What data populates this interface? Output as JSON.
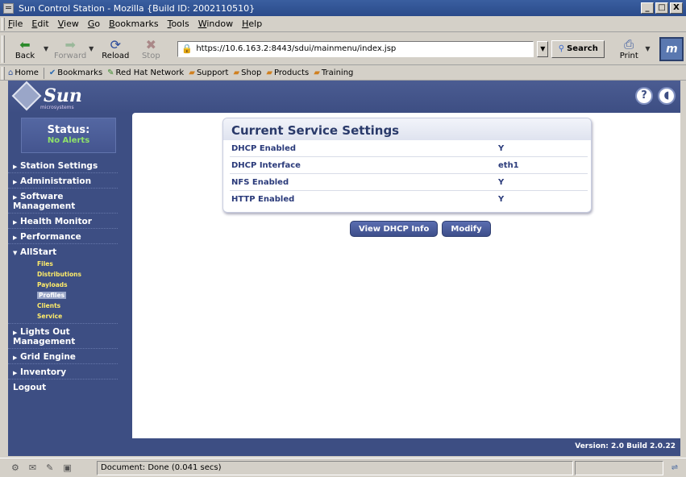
{
  "window": {
    "title": "Sun Control Station - Mozilla {Build ID: 2002110510}",
    "controls": [
      "_",
      "□",
      "X"
    ]
  },
  "menubar": [
    "File",
    "Edit",
    "View",
    "Go",
    "Bookmarks",
    "Tools",
    "Window",
    "Help"
  ],
  "toolbar": {
    "back": "Back",
    "forward": "Forward",
    "reload": "Reload",
    "stop": "Stop",
    "url": "https://10.6.163.2:8443/sdui/mainmenu/index.jsp",
    "search": "Search",
    "print": "Print"
  },
  "bookmarks": [
    "Home",
    "Bookmarks",
    "Red Hat Network",
    "Support",
    "Shop",
    "Products",
    "Training"
  ],
  "page": {
    "status_label": "Status:",
    "status_value": "No Alerts",
    "nav": [
      {
        "label": "Station Settings",
        "arrow": "right"
      },
      {
        "label": "Administration",
        "arrow": "right"
      },
      {
        "label": "Software Management",
        "arrow": "right"
      },
      {
        "label": "Health Monitor",
        "arrow": "right"
      },
      {
        "label": "Performance",
        "arrow": "right"
      },
      {
        "label": "AllStart",
        "arrow": "down"
      },
      {
        "label": "Lights Out Management",
        "arrow": "right"
      },
      {
        "label": "Grid Engine",
        "arrow": "right"
      },
      {
        "label": "Inventory",
        "arrow": "right"
      },
      {
        "label": "Logout",
        "arrow": "none"
      }
    ],
    "allstart_sub": [
      "Files",
      "Distributions",
      "Payloads",
      "Profiles",
      "Clients",
      "Service"
    ],
    "selected_sub": "Profiles",
    "card": {
      "title": "Current Service Settings",
      "rows": [
        {
          "key": "DHCP Enabled",
          "value": "Y"
        },
        {
          "key": "DHCP Interface",
          "value": "eth1"
        },
        {
          "key": "NFS Enabled",
          "value": "Y"
        },
        {
          "key": "HTTP Enabled",
          "value": "Y"
        }
      ]
    },
    "buttons": {
      "view_dhcp": "View DHCP Info",
      "modify": "Modify"
    },
    "version": "Version: 2.0 Build 2.0.22",
    "help_icon": "?",
    "volume_icon": "◖"
  },
  "statusbar": {
    "text": "Document: Done (0.041 secs)"
  },
  "colors": {
    "sun_blue": "#3d4e83",
    "status_green": "#8fe16a",
    "sub_yellow": "#ffec6a"
  }
}
